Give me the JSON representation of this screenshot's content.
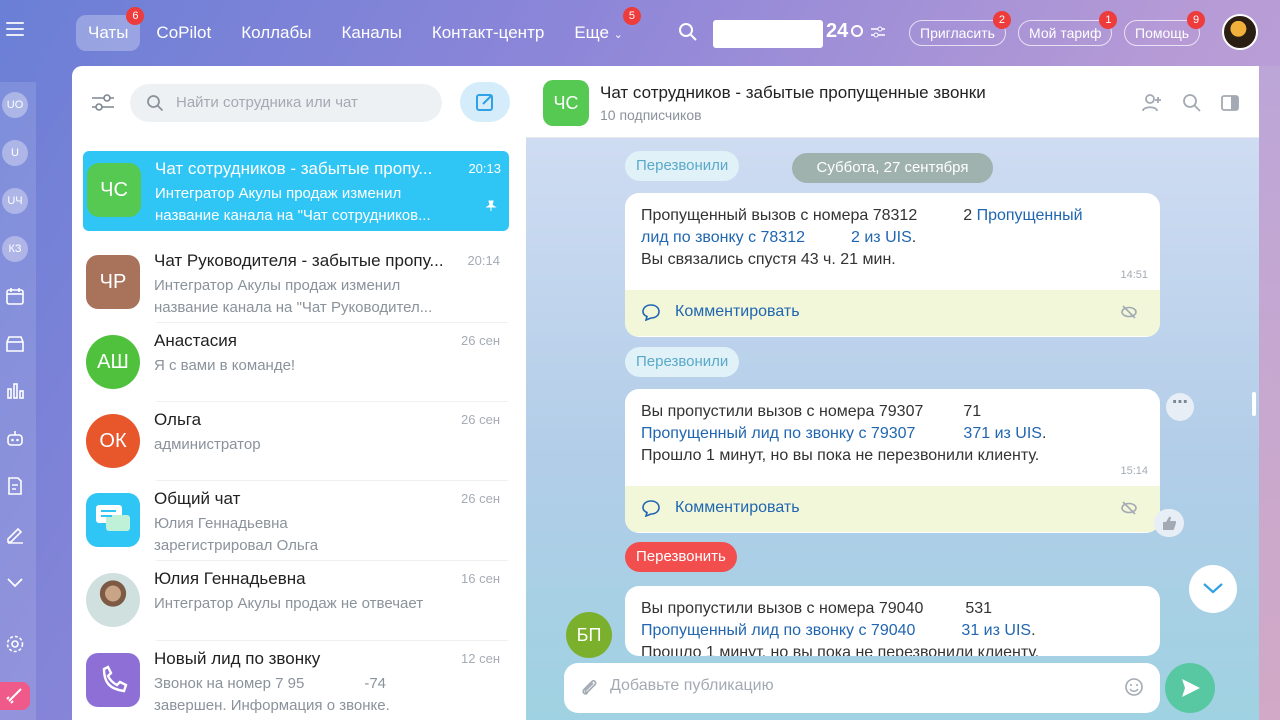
{
  "topbar": {
    "nav": [
      {
        "label": "Чаты",
        "badge": "6"
      },
      {
        "label": "CoPilot",
        "badge": ""
      },
      {
        "label": "Коллабы",
        "badge": ""
      },
      {
        "label": "Каналы",
        "badge": ""
      },
      {
        "label": "Контакт-центр",
        "badge": ""
      },
      {
        "label": "Еще",
        "badge": "5"
      }
    ],
    "clock": "24",
    "invite": {
      "label": "Пригласить",
      "badge": "2"
    },
    "tariff": {
      "label": "Мой тариф",
      "badge": "1"
    },
    "help": {
      "label": "Помощь",
      "badge": "9"
    }
  },
  "rail": {
    "items": [
      "UO",
      "U",
      "UЧ",
      "КЗ"
    ]
  },
  "list": {
    "search_placeholder": "Найти сотрудника или чат",
    "chats": [
      {
        "initials": "ЧС",
        "color": "#55c951",
        "name": "Чат сотрудников - забытые пропу...",
        "time": "20:13",
        "line1": "Интегратор Акулы продаж изменил",
        "line2": "название канала на \"Чат сотрудников...",
        "pinned": true
      },
      {
        "initials": "ЧР",
        "color": "#a8735a",
        "name": "Чат Руководителя - забытые пропу...",
        "time": "20:14",
        "line1": "Интегратор Акулы продаж изменил",
        "line2": "название канала на \"Чат Руководител..."
      },
      {
        "initials": "АШ",
        "color": "#4fc13c",
        "name": "Анастасия",
        "time": "26 сен",
        "line1": "Я с вами в команде!",
        "line2": ""
      },
      {
        "initials": "ОК",
        "color": "#e8562c",
        "name": "Ольга",
        "time": "26 сен",
        "line1": "администратор",
        "line2": ""
      },
      {
        "initials": "",
        "color": "#2fc6f6",
        "name": "Общий чат",
        "time": "26 сен",
        "line1": "Юлия Геннадьевна",
        "line2": "зарегистрировал Ольга"
      },
      {
        "initials": "",
        "color": "#b8c4c4",
        "name": "Юлия Геннадьевна",
        "time": "16 сен",
        "line1": "Интегратор Акулы продаж не отвечает",
        "line2": ""
      },
      {
        "initials": "",
        "color": "#8e6fd6",
        "name": "Новый лид по звонку",
        "time": "12 сен",
        "line1": "Звонок на номер 7 95",
        "line1b": "-74",
        "line2": "завершен. Информация о звонке."
      }
    ]
  },
  "chat": {
    "title": "Чат сотрудников - забытые пропущенные звонки",
    "subtitle": "10 подписчиков",
    "avatar": "ЧС",
    "tag_callback_done": "Перезвонили",
    "date": "Суббота, 27 сентября",
    "msg1": {
      "line1": "Пропущенный вызов с номера 78312",
      "line1b": "2",
      "link1": "Пропущенный",
      "link2": "лид по звонку с 78312",
      "link2b": "2 из UIS",
      "line3": "Вы связались спустя 43 ч. 21 мин.",
      "time": "14:51"
    },
    "msg2": {
      "line1": "Вы пропустили вызов с номера 79307",
      "line1b": "71",
      "link": "Пропущенный лид по звонку с 79307",
      "linkb": "371 из UIS",
      "line3": "Прошло 1 минут, но вы пока не перезвонили клиенту.",
      "time": "15:14"
    },
    "msg3": {
      "line1": "Вы пропустили вызов с номера 79040",
      "line1b": "531",
      "link": "Пропущенный лид по звонку с 79040",
      "linkb": "31 из UIS",
      "line3": "Прошло 1 минут, но вы пока не перезвонили клиенту."
    },
    "comment_label": "Комментировать",
    "tag_callback": "Перезвонить",
    "sender_initials": "БП",
    "composer_placeholder": "Добавьте публикацию"
  }
}
